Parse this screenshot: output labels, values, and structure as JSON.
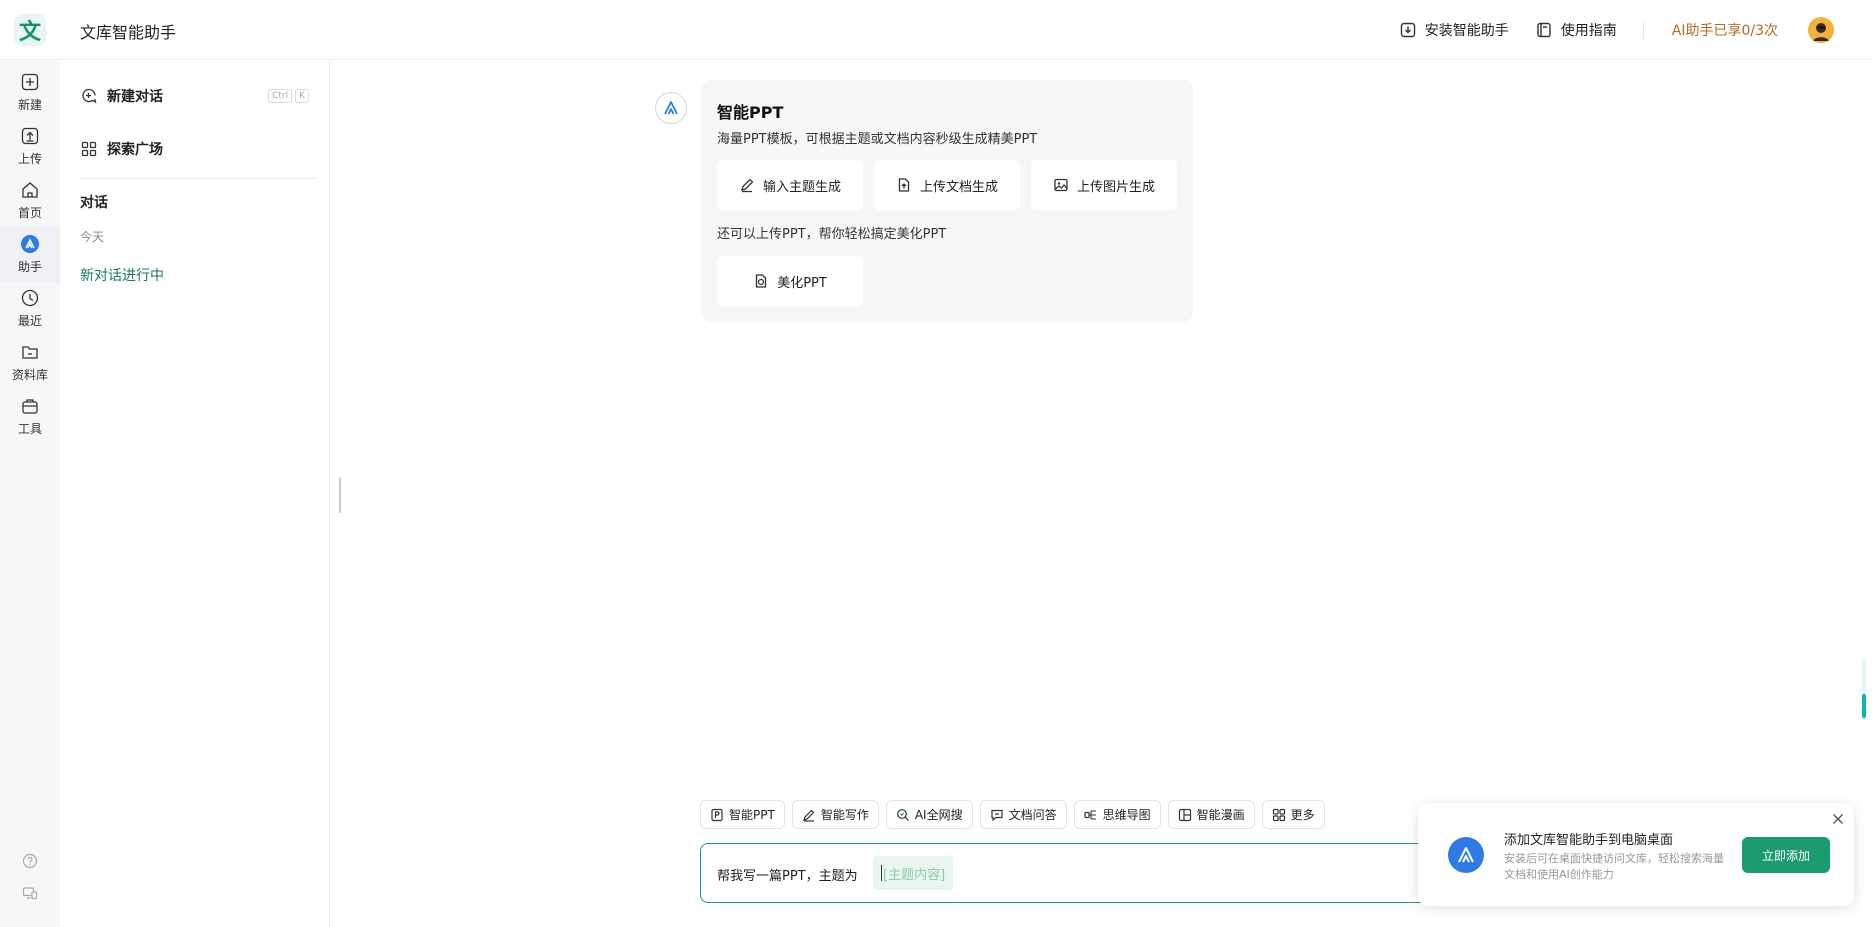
{
  "header": {
    "logo_char": "文",
    "title": "文库智能助手",
    "install_label": "安装智能助手",
    "guide_label": "使用指南",
    "quota_text": "AI助手已享0/3次"
  },
  "rail": {
    "items": [
      {
        "label": "新建",
        "icon": "plus-icon"
      },
      {
        "label": "上传",
        "icon": "upload-icon"
      },
      {
        "label": "首页",
        "icon": "home-icon"
      },
      {
        "label": "助手",
        "icon": "assistant-icon"
      },
      {
        "label": "最近",
        "icon": "clock-icon"
      },
      {
        "label": "资料库",
        "icon": "folder-icon"
      },
      {
        "label": "工具",
        "icon": "toolbox-icon"
      }
    ]
  },
  "sidebar": {
    "new_chat_label": "新建对话",
    "shortcut": [
      "Ctrl",
      "K"
    ],
    "explore_label": "探索广场",
    "section_title": "对话",
    "date_group": "今天",
    "conversation": "新对话进行中"
  },
  "card": {
    "title": "智能PPT",
    "description": "海量PPT模板，可根据主题或文档内容秒级生成精美PPT",
    "buttons": [
      "输入主题生成",
      "上传文档生成",
      "上传图片生成"
    ],
    "sub_text": "还可以上传PPT，帮你轻松搞定美化PPT",
    "beautify_label": "美化PPT"
  },
  "tools": [
    "智能PPT",
    "智能写作",
    "AI全网搜",
    "文档问答",
    "思维导图",
    "智能漫画",
    "更多"
  ],
  "input": {
    "prefix": "帮我写一篇PPT，主题为",
    "slot_placeholder": "[主题内容]"
  },
  "toast": {
    "title": "添加文库智能助手到电脑桌面",
    "description": "安装后可在桌面快捷访问文库，轻松搜索海量文档和使用AI创作能力",
    "button": "立即添加"
  },
  "colors": {
    "brand_green": "#1c9a72",
    "accent_blue": "#2f7ae5",
    "quota_orange": "#b56a20"
  }
}
